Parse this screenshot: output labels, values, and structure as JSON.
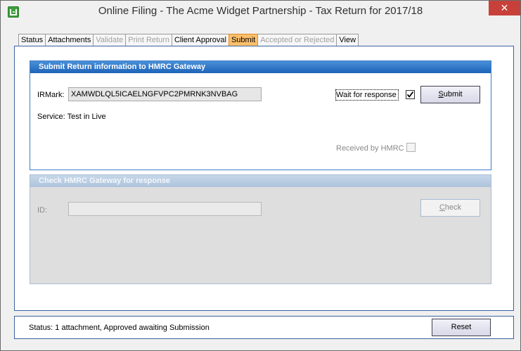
{
  "window": {
    "title": "Online Filing - The Acme Widget Partnership - Tax Return for 2017/18",
    "close_glyph": "✕"
  },
  "tabs": [
    {
      "label": "Status",
      "state": "enabled"
    },
    {
      "label": "Attachments",
      "state": "enabled"
    },
    {
      "label": "Validate",
      "state": "disabled"
    },
    {
      "label": "Print Return",
      "state": "disabled"
    },
    {
      "label": "Client Approval",
      "state": "enabled"
    },
    {
      "label": "Submit",
      "state": "active"
    },
    {
      "label": "Accepted or Rejected",
      "state": "disabled"
    },
    {
      "label": "View",
      "state": "enabled"
    }
  ],
  "submit_group": {
    "header": "Submit Return information to HMRC Gateway",
    "irmark_label": "IRMark:",
    "irmark_value": "XAMWDLQL5ICAELNGFVPC2PMRNK3NVBAG",
    "service_text": "Service: Test in Live",
    "wait_label": "Wait for response",
    "wait_checked": true,
    "submit_button": "Submit",
    "received_label": "Received by HMRC",
    "received_checked": false
  },
  "check_group": {
    "header": "Check HMRC Gateway for response",
    "id_label": "ID:",
    "id_value": "",
    "check_button": "Check"
  },
  "status_bar": {
    "text": "Status: 1 attachment, Approved awaiting Submission",
    "reset_button": "Reset"
  },
  "colors": {
    "active_tab": "#fbbf6b",
    "group_header": "#1d63b8",
    "close_button": "#c7413a",
    "panel_border": "#3a63a0"
  }
}
